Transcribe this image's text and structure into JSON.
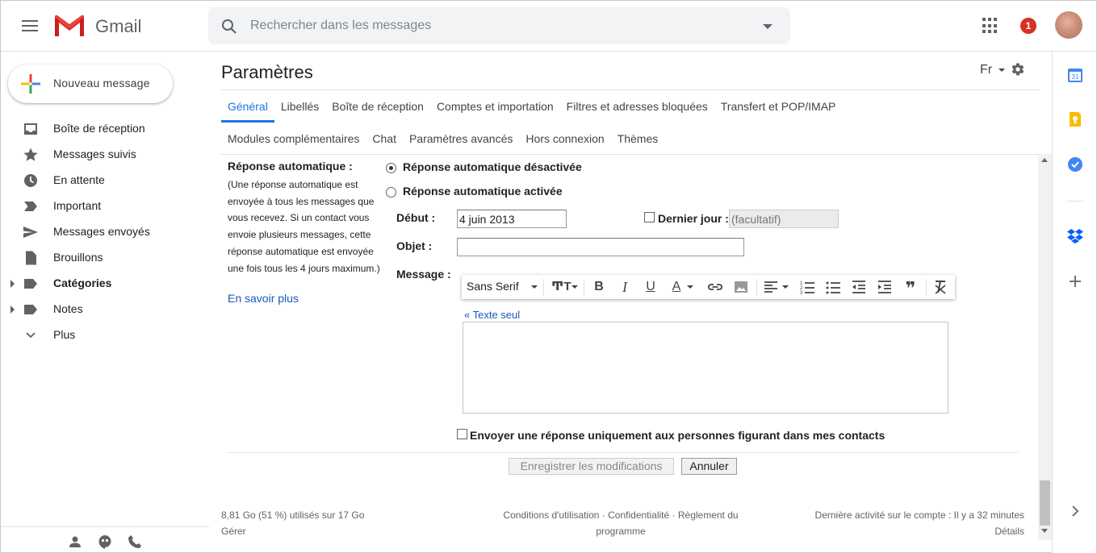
{
  "header": {
    "app_name": "Gmail",
    "search_placeholder": "Rechercher dans les messages",
    "notification_count": "1"
  },
  "sidebar": {
    "compose_label": "Nouveau message",
    "items": [
      {
        "label": "Boîte de réception",
        "icon": "inbox-icon"
      },
      {
        "label": "Messages suivis",
        "icon": "star-icon"
      },
      {
        "label": "En attente",
        "icon": "clock-icon"
      },
      {
        "label": "Important",
        "icon": "important-icon"
      },
      {
        "label": "Messages envoyés",
        "icon": "send-icon"
      },
      {
        "label": "Brouillons",
        "icon": "draft-icon"
      },
      {
        "label": "Catégories",
        "icon": "label-icon"
      },
      {
        "label": "Notes",
        "icon": "label-icon"
      },
      {
        "label": "Plus",
        "icon": "chevron-down-icon"
      }
    ]
  },
  "main": {
    "title": "Paramètres",
    "language": "Fr",
    "tabs_row1": [
      "Général",
      "Libellés",
      "Boîte de réception",
      "Comptes et importation",
      "Filtres et adresses bloquées",
      "Transfert et POP/IMAP"
    ],
    "tabs_row2": [
      "Modules complémentaires",
      "Chat",
      "Paramètres avancés",
      "Hors connexion",
      "Thèmes"
    ],
    "active_tab": "Général"
  },
  "autoreply": {
    "label": "Réponse automatique :",
    "description": "(Une réponse automatique est envoyée à tous les messages que vous recevez. Si un contact vous envoie plusieurs messages, cette réponse automatique est envoyée une fois tous les 4 jours maximum.)",
    "learn_more": "En savoir plus",
    "option_off": "Réponse automatique désactivée",
    "option_on": "Réponse automatique activée",
    "start_label": "Début :",
    "start_value": "4 juin 2013",
    "last_day_label": "Dernier jour :",
    "last_day_placeholder": "(facultatif)",
    "subject_label": "Objet :",
    "subject_value": "",
    "message_label": "Message :",
    "font_name": "Sans Serif",
    "plain_text_link": "« Texte seul",
    "contacts_only_label": "Envoyer une réponse uniquement aux personnes figurant dans mes contacts"
  },
  "actions": {
    "save_label": "Enregistrer les modifications",
    "cancel_label": "Annuler"
  },
  "footer": {
    "storage": "8,81 Go (51 %) utilisés sur 17 Go",
    "manage": "Gérer",
    "terms": "Conditions d'utilisation",
    "privacy": "Confidentialité",
    "policy_line1": "Règlement du",
    "policy_line2": "programme",
    "last_activity": "Dernière activité sur le compte : Il y a 32 minutes",
    "details": "Détails"
  },
  "side_panel": {
    "calendar_day": "31"
  },
  "colors": {
    "accent": "#1a73e8",
    "link": "#1a57b8",
    "badge": "#d93025"
  }
}
